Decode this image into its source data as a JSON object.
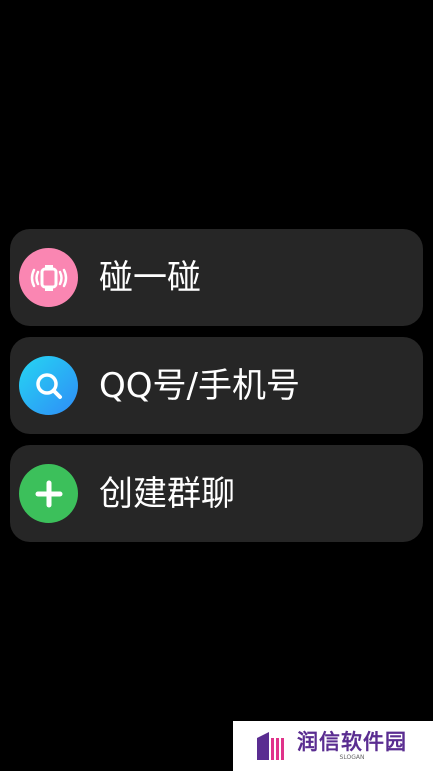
{
  "menu": {
    "items": [
      {
        "label": "碰一碰",
        "icon": "shake-watch-icon",
        "color": "#fa86b2"
      },
      {
        "label": "QQ号/手机号",
        "icon": "search-icon",
        "color": "#2f8cf7"
      },
      {
        "label": "创建群聊",
        "icon": "plus-icon",
        "color": "#3cc05b"
      }
    ]
  },
  "watermark": {
    "name": "润信软件园",
    "slogan": "SLOGAN",
    "brand_color": "#5a2d91"
  }
}
